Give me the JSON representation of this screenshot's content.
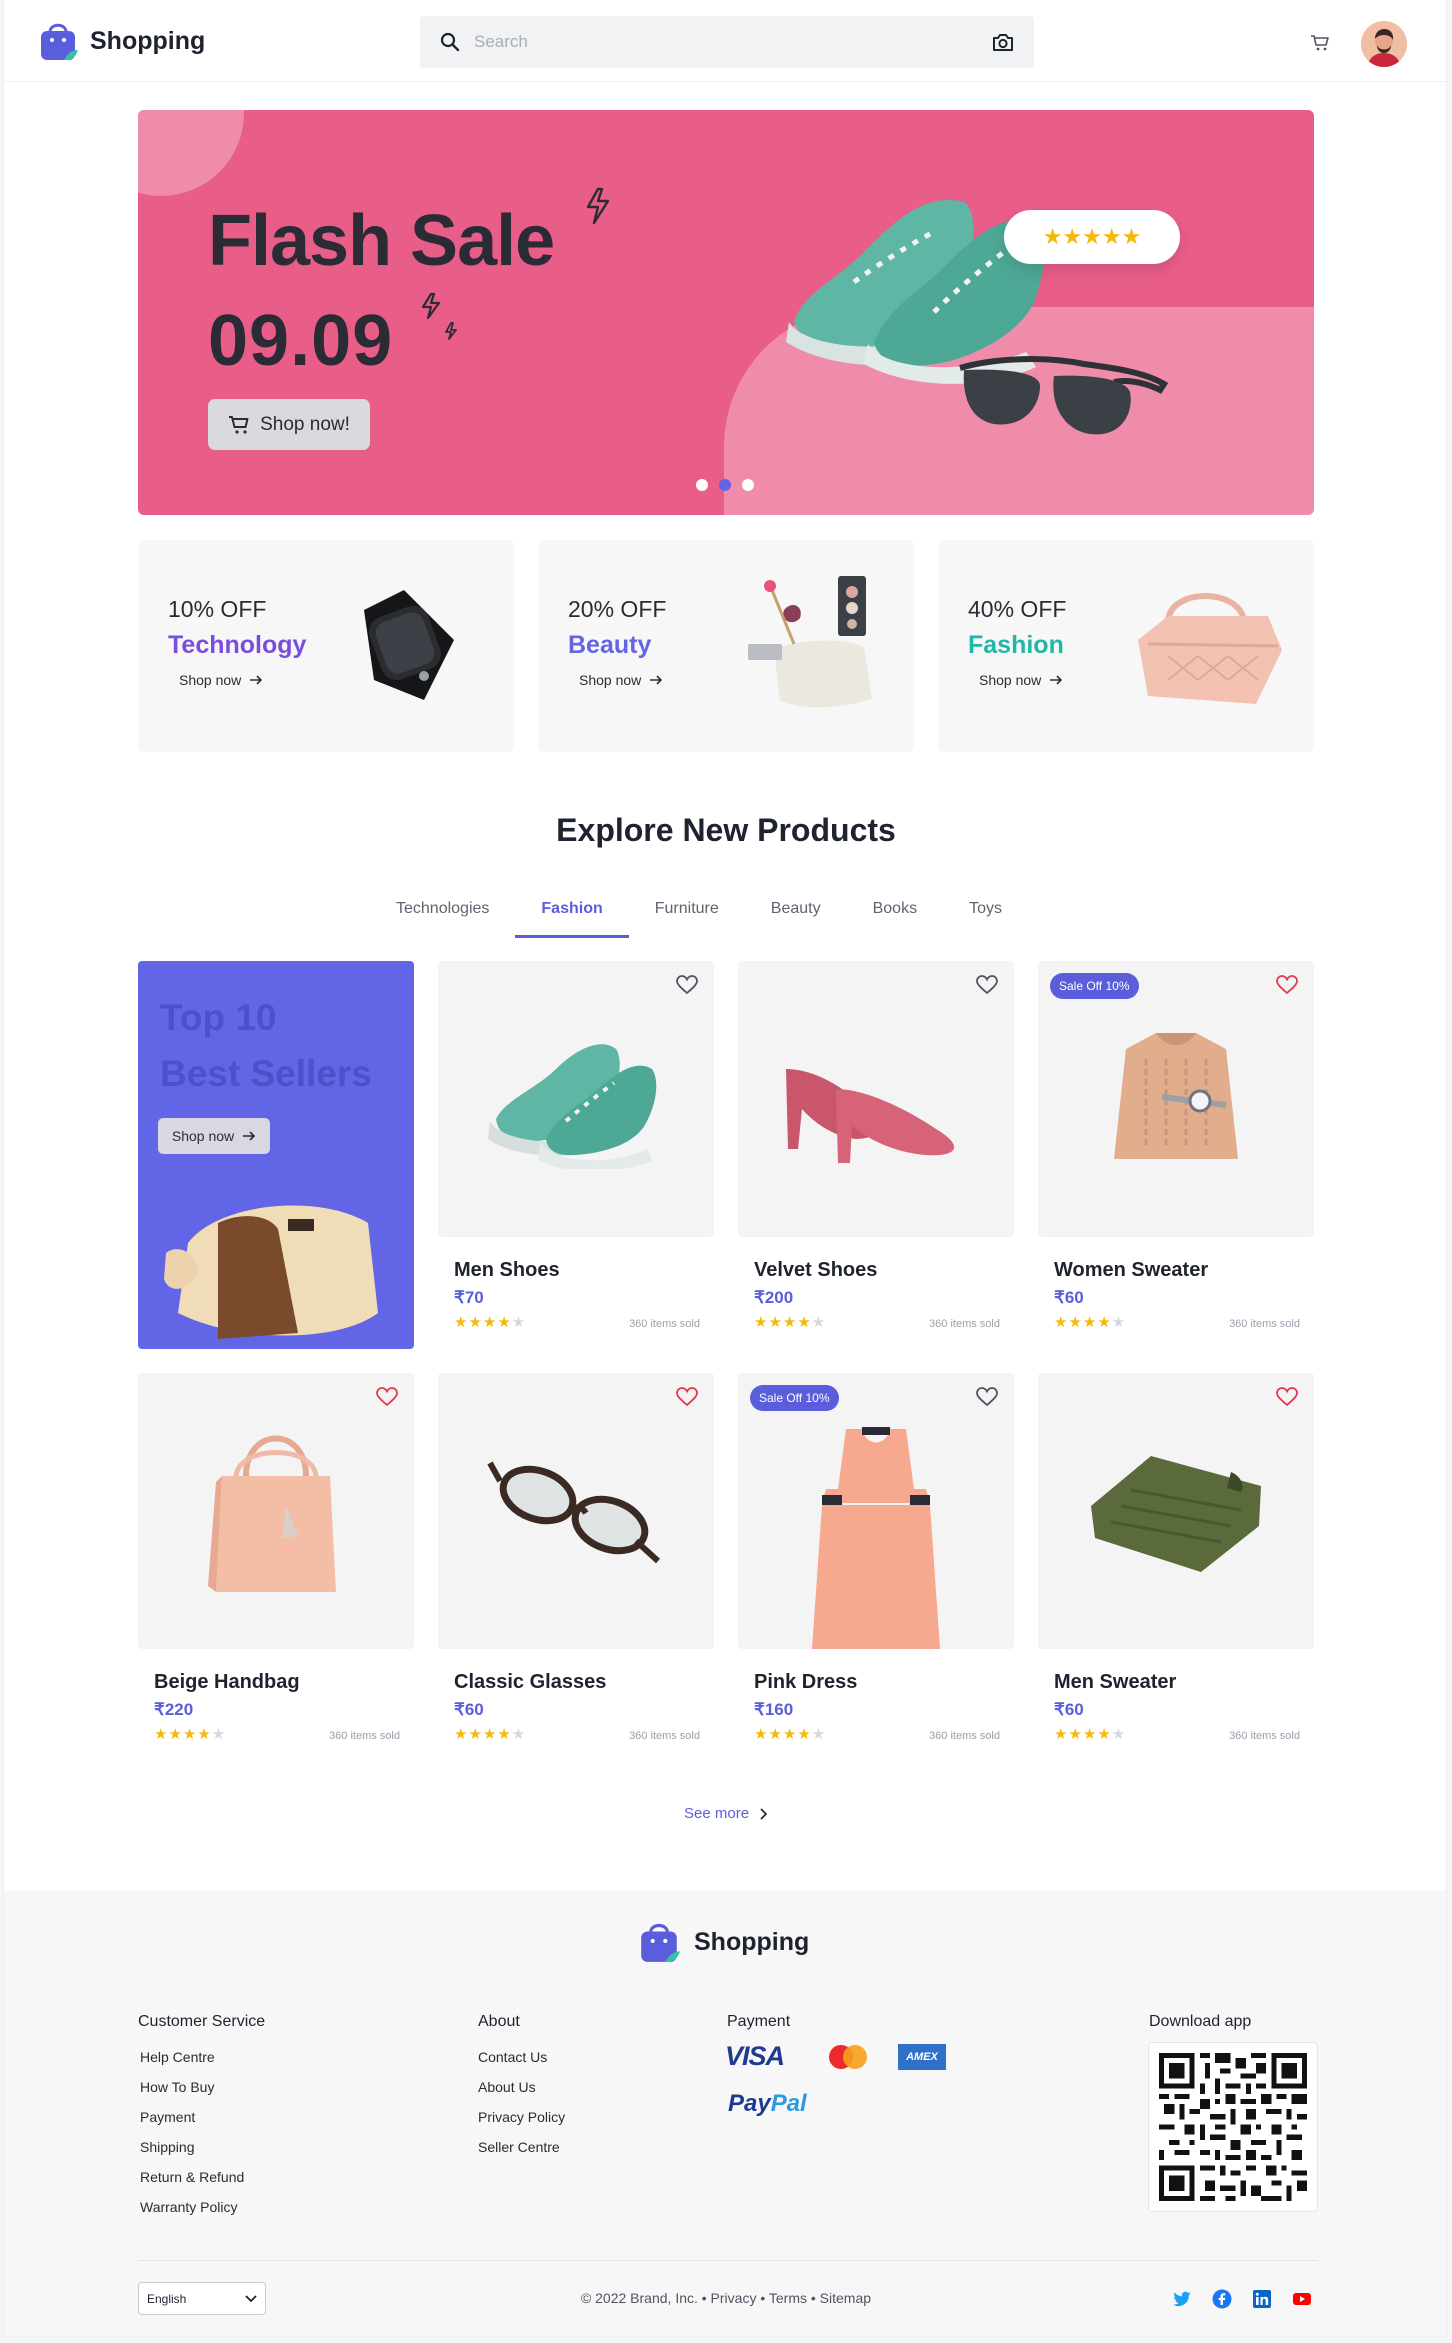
{
  "header": {
    "brand": "Shopping",
    "search_placeholder": "Search"
  },
  "hero": {
    "title": "Flash Sale",
    "date": "09.09",
    "button_label": "Shop now!",
    "rating_stars": "★★★★★",
    "slide_count": 3,
    "active_slide": 2
  },
  "promos": [
    {
      "discount": "10% OFF",
      "category": "Technology",
      "link": "Shop now",
      "color": "#7a4de0"
    },
    {
      "discount": "20% OFF",
      "category": "Beauty",
      "link": "Shop now",
      "color": "#6265e5"
    },
    {
      "discount": "40% OFF",
      "category": "Fashion",
      "link": "Shop now",
      "color": "#1fb8a6"
    }
  ],
  "section": {
    "title": "Explore New Products",
    "tabs": [
      "Technologies",
      "Fashion",
      "Furniture",
      "Beauty",
      "Books",
      "Toys"
    ],
    "active_tab": "Fashion"
  },
  "bestseller": {
    "line1": "Top 10",
    "line2": "Best Sellers",
    "button_label": "Shop now"
  },
  "products": [
    {
      "name": "Men Shoes",
      "price": "₹70",
      "sold": "360 items sold",
      "rating": 4,
      "badge": "",
      "favorited": false
    },
    {
      "name": "Velvet Shoes",
      "price": "₹200",
      "sold": "360 items sold",
      "rating": 4,
      "badge": "",
      "favorited": false
    },
    {
      "name": "Women Sweater",
      "price": "₹60",
      "sold": "360 items sold",
      "rating": 4,
      "badge": "Sale Off 10%",
      "favorited": true
    },
    {
      "name": "Beige Handbag",
      "price": "₹220",
      "sold": "360 items sold",
      "rating": 4,
      "badge": "",
      "favorited": true
    },
    {
      "name": "Classic Glasses",
      "price": "₹60",
      "sold": "360 items sold",
      "rating": 4,
      "badge": "",
      "favorited": true
    },
    {
      "name": "Pink Dress",
      "price": "₹160",
      "sold": "360 items sold",
      "rating": 4,
      "badge": "Sale Off 10%",
      "favorited": false
    },
    {
      "name": "Men Sweater",
      "price": "₹60",
      "sold": "360 items sold",
      "rating": 4,
      "badge": "",
      "favorited": true
    }
  ],
  "see_more": "See more",
  "footer": {
    "brand": "Shopping",
    "customer_service": {
      "title": "Customer Service",
      "links": [
        "Help Centre",
        "How To Buy",
        "Payment",
        "Shipping",
        "Return & Refund",
        "Warranty Policy"
      ]
    },
    "about": {
      "title": "About",
      "links": [
        "Contact Us",
        "About Us",
        "Privacy Policy",
        "Seller Centre"
      ]
    },
    "payment": {
      "title": "Payment",
      "visa": "VISA",
      "amex": "AMEX",
      "paypal_a": "Pay",
      "paypal_b": "Pal"
    },
    "download": {
      "title": "Download app"
    },
    "language": "English",
    "copyright": "© 2022 Brand, Inc. • Privacy • Terms • Sitemap"
  },
  "colors": {
    "accent": "#5b5edc",
    "hero_bg": "#e95e89",
    "star": "#f5b90a",
    "favorite": "#e53a4a"
  }
}
